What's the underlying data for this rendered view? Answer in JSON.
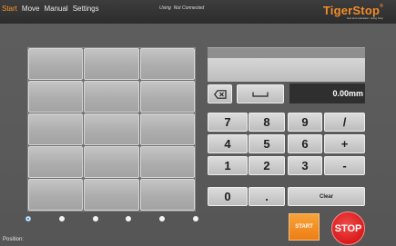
{
  "menu": {
    "items": [
      "Start",
      "Move",
      "Manual",
      "Settings"
    ],
    "active": "Start"
  },
  "status": {
    "label": "Using",
    "value": "Not Connected"
  },
  "logo": {
    "text": "TigerStop",
    "mark": "®",
    "tagline": "feet and calculate i using Stop"
  },
  "display": {
    "readout": "0.00mm"
  },
  "keypad": {
    "row1": [
      "7",
      "8",
      "9",
      "/"
    ],
    "row2": [
      "4",
      "5",
      "6",
      "+"
    ],
    "row3": [
      "1",
      "2",
      "3",
      "-"
    ],
    "zero": "0",
    "dot": ".",
    "clear": "Clear"
  },
  "controls": {
    "start": "START",
    "stop": "STOP"
  },
  "footer": {
    "position_label": "Position:",
    "position_value": ""
  },
  "pages": {
    "count": 6,
    "selected": 1
  },
  "colors": {
    "accent": "#f28b2a",
    "stop": "#d91b1b",
    "readout_bg": "#2f2f2f"
  }
}
